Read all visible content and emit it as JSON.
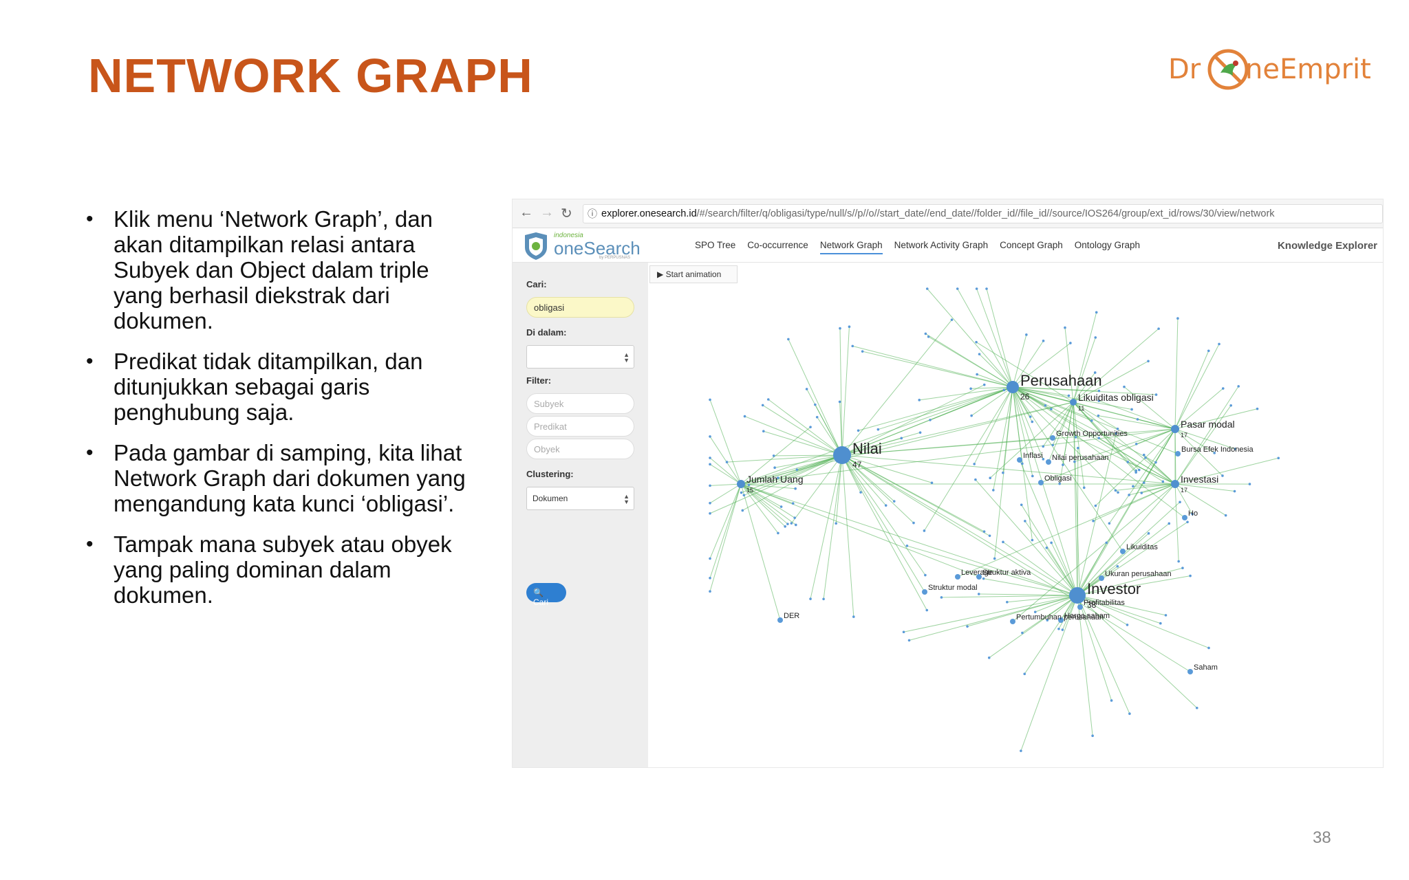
{
  "slide": {
    "title": "NETWORK GRAPH",
    "logo_left": "Dr",
    "logo_right": "neEmprit",
    "page_number": "38"
  },
  "bullets": [
    "Klik menu ‘Network Graph’, dan akan ditampilkan relasi antara Subyek dan Object dalam triple yang berhasil diekstrak dari dokumen.",
    "Predikat tidak ditampilkan, dan ditunjukkan sebagai garis penghubung saja.",
    "Pada gambar di samping, kita lihat Network Graph dari dokumen yang mengandung kata kunci ‘obligasi’.",
    "Tampak mana subyek atau obyek yang paling dominan dalam dokumen."
  ],
  "browser": {
    "url_domain": "explorer.onesearch.id",
    "url_path": "/#/search/filter/q/obligasi/type/null/s//p//o//start_date//end_date//folder_id//file_id//source/IOS264/group/ext_id/rows/30/view/network"
  },
  "app": {
    "logo_small": "indonesia",
    "logo_big": "oneSearch",
    "logo_sub": "by PERPUSNAS",
    "menu": [
      "SPO Tree",
      "Co-occurrence",
      "Network Graph",
      "Network Activity Graph",
      "Concept Graph",
      "Ontology Graph"
    ],
    "brand": "Knowledge Explorer"
  },
  "sidebar": {
    "cari_label": "Cari:",
    "cari_value": "obligasi",
    "di_dalam_label": "Di dalam:",
    "filter_label": "Filter:",
    "subyek_placeholder": "Subyek",
    "predikat_placeholder": "Predikat",
    "obyek_placeholder": "Obyek",
    "clustering_label": "Clustering:",
    "clustering_value": "Dokumen",
    "cari_button": "Cari"
  },
  "graph": {
    "start_animation": "▶ Start animation",
    "hubs": [
      {
        "label": "Nilai",
        "count": "47"
      },
      {
        "label": "Perusahaan",
        "count": "26"
      },
      {
        "label": "Investor",
        "count": "38"
      },
      {
        "label": "Likuiditas obligasi",
        "count": "11"
      },
      {
        "label": "Pasar modal",
        "count": "17"
      },
      {
        "label": "Investasi",
        "count": "17"
      },
      {
        "label": "Jumlah Uang",
        "count": "15"
      }
    ],
    "labels": [
      "Growth Opportunities",
      "Bursa Efek Indonesia",
      "Inflasi",
      "Nilai perusahaan",
      "Obligasi",
      "Leverage",
      "Struktur aktiva",
      "Struktur modal",
      "Likuiditas",
      "Ukuran perusahaan",
      "Profitabilitas",
      "Harga saham",
      "Pertumbuhan perusahaan",
      "DER",
      "Saham",
      "Ho"
    ]
  }
}
